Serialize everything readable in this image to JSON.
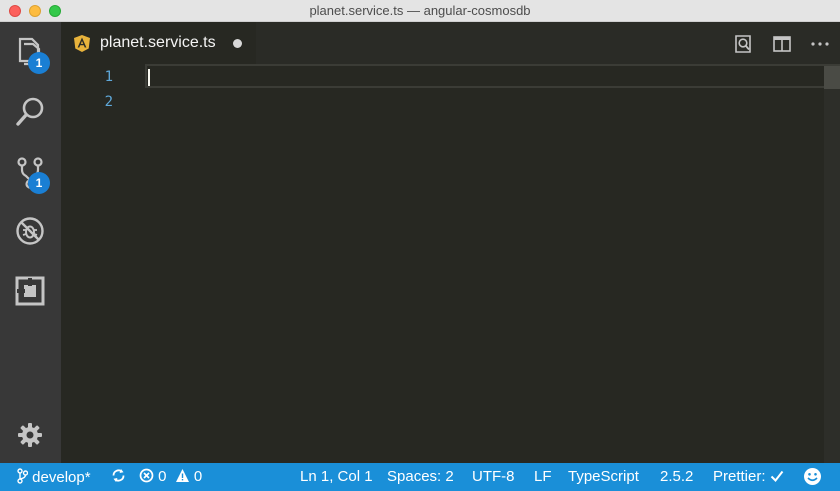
{
  "window": {
    "title": "planet.service.ts — angular-cosmosdb"
  },
  "activity_bar": {
    "items": [
      {
        "name": "explorer",
        "icon": "files-icon",
        "badge": "1"
      },
      {
        "name": "search",
        "icon": "search-icon"
      },
      {
        "name": "source-control",
        "icon": "source-control-icon",
        "badge": "1"
      },
      {
        "name": "debug",
        "icon": "debug-icon"
      },
      {
        "name": "extensions",
        "icon": "extensions-icon"
      }
    ],
    "settings_icon": "gear-icon"
  },
  "editor_tab": {
    "label": "planet.service.ts",
    "file_icon": "angular-icon",
    "dirty": true
  },
  "tab_actions": [
    {
      "name": "open-preview",
      "icon": "open-preview-icon"
    },
    {
      "name": "split-editor",
      "icon": "split-editor-icon"
    },
    {
      "name": "more-actions",
      "icon": "ellipsis-icon"
    }
  ],
  "editor": {
    "line_numbers": [
      "1",
      "2"
    ],
    "colors": {
      "background": "#272822",
      "line_number": "#5fa8d9"
    }
  },
  "status_bar": {
    "branch": "develop*",
    "errors": "0",
    "warnings": "0",
    "position": "Ln 1, Col 1",
    "indentation": "Spaces: 2",
    "encoding": "UTF-8",
    "eol": "LF",
    "language": "TypeScript",
    "version": "2.5.2",
    "prettier": "Prettier:",
    "background": "#1a8fd8"
  }
}
